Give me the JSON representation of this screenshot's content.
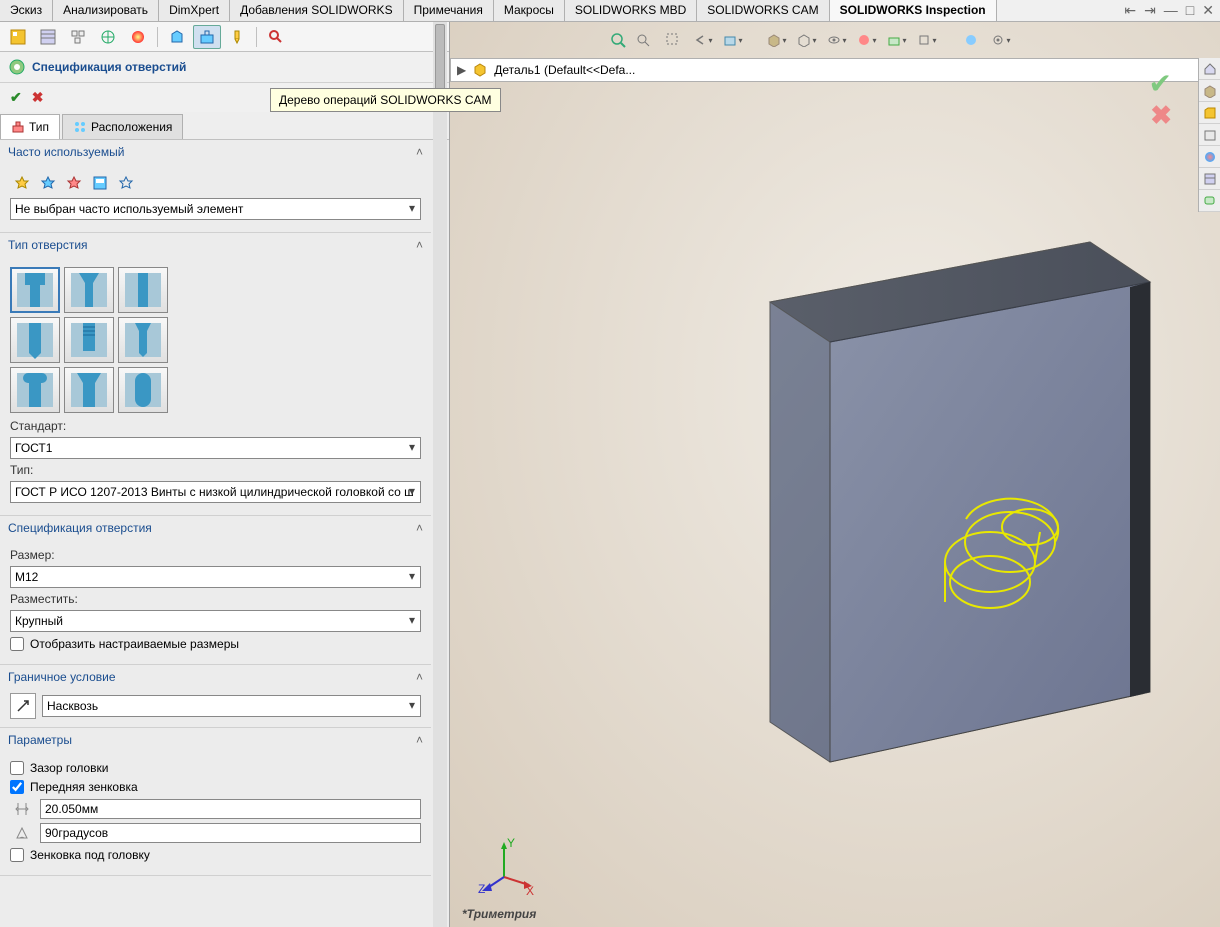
{
  "tabs": [
    "Эскиз",
    "Анализировать",
    "DimXpert",
    "Добавления SOLIDWORKS",
    "Примечания",
    "Макросы",
    "SOLIDWORKS MBD",
    "SOLIDWORKS CAM",
    "SOLIDWORKS Inspection"
  ],
  "active_tab": "SOLIDWORKS Inspection",
  "tooltip": "Дерево операций SOLIDWORKS CAM",
  "breadcrumb": {
    "part": "Деталь1",
    "rest": "(Default<<Defa..."
  },
  "prop": {
    "title": "Спецификация отверстий"
  },
  "subtabs": {
    "type": "Тип",
    "positions": "Расположения"
  },
  "sections": {
    "favorites": {
      "title": "Часто используемый",
      "select": "Не выбран часто используемый элемент"
    },
    "hole_type": {
      "title": "Тип отверстия",
      "standard_label": "Стандарт:",
      "standard": "ГОСТ1",
      "type_label": "Тип:",
      "type": "ГОСТ Р ИСО 1207-2013 Винты с низкой цилиндрической головкой со ш"
    },
    "hole_spec": {
      "title": "Спецификация отверстия",
      "size_label": "Размер:",
      "size": "M12",
      "fit_label": "Разместить:",
      "fit": "Крупный",
      "custom": "Отобразить настраиваемые размеры"
    },
    "end_cond": {
      "title": "Граничное условие",
      "value": "Насквозь"
    },
    "options": {
      "title": "Параметры",
      "opt1": "Зазор головки",
      "opt2": "Передняя зенковка",
      "val1": "20.050мм",
      "val2": "90градусов",
      "opt3": "Зенковка под головку"
    }
  },
  "view_label": "*Триметрия"
}
